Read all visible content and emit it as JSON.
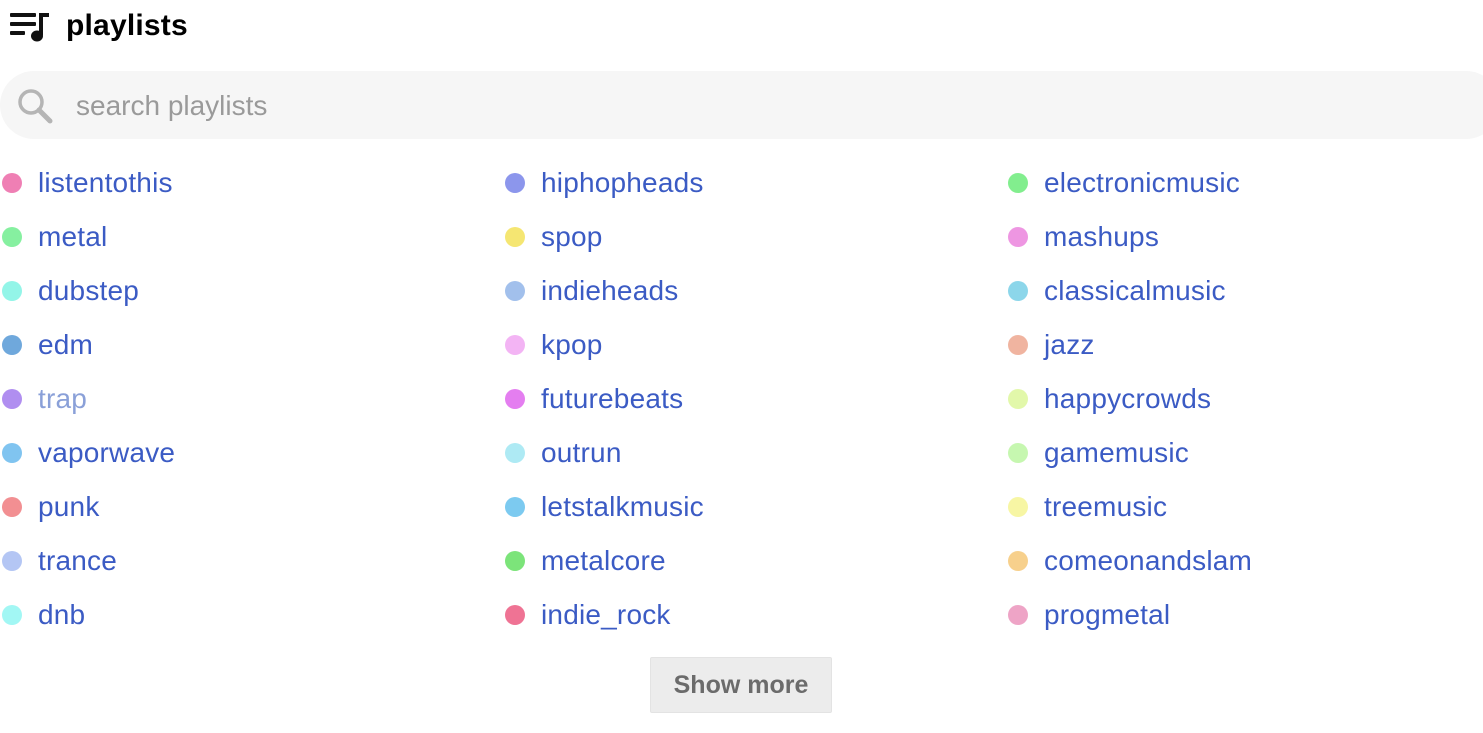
{
  "header": {
    "icon": "playlist-icon",
    "title": "playlists"
  },
  "search": {
    "icon": "search-icon",
    "placeholder": "search playlists",
    "value": ""
  },
  "playlists": {
    "columns": [
      [
        {
          "name": "listentothis",
          "color": "#ef7fb4"
        },
        {
          "name": "metal",
          "color": "#86f0a0"
        },
        {
          "name": "dubstep",
          "color": "#93f5e8"
        },
        {
          "name": "edm",
          "color": "#6fa8dc"
        },
        {
          "name": "trap",
          "color": "#b08ef0",
          "dim": true
        },
        {
          "name": "vaporwave",
          "color": "#80c4f0"
        },
        {
          "name": "punk",
          "color": "#f28f92"
        },
        {
          "name": "trance",
          "color": "#b4c6f4"
        },
        {
          "name": "dnb",
          "color": "#a2f7f4"
        }
      ],
      [
        {
          "name": "hiphopheads",
          "color": "#8c96ec"
        },
        {
          "name": "spop",
          "color": "#f5e672"
        },
        {
          "name": "indieheads",
          "color": "#a2c0ec"
        },
        {
          "name": "kpop",
          "color": "#f3b4f4"
        },
        {
          "name": "futurebeats",
          "color": "#e47ef0"
        },
        {
          "name": "outrun",
          "color": "#aeeaf4"
        },
        {
          "name": "letstalkmusic",
          "color": "#7ccaf0"
        },
        {
          "name": "metalcore",
          "color": "#7ce47a"
        },
        {
          "name": "indie_rock",
          "color": "#ef7394"
        }
      ],
      [
        {
          "name": "electronicmusic",
          "color": "#82ee8e"
        },
        {
          "name": "mashups",
          "color": "#ee96e2"
        },
        {
          "name": "classicalmusic",
          "color": "#8cd6ea"
        },
        {
          "name": "jazz",
          "color": "#f0b4a0"
        },
        {
          "name": "happycrowds",
          "color": "#e2f8aa"
        },
        {
          "name": "gamemusic",
          "color": "#c6f7b0"
        },
        {
          "name": "treemusic",
          "color": "#f7f6a4"
        },
        {
          "name": "comeonandslam",
          "color": "#f7d08c"
        },
        {
          "name": "progmetal",
          "color": "#eea4c6"
        }
      ]
    ]
  },
  "actions": {
    "show_more_label": "Show more"
  }
}
